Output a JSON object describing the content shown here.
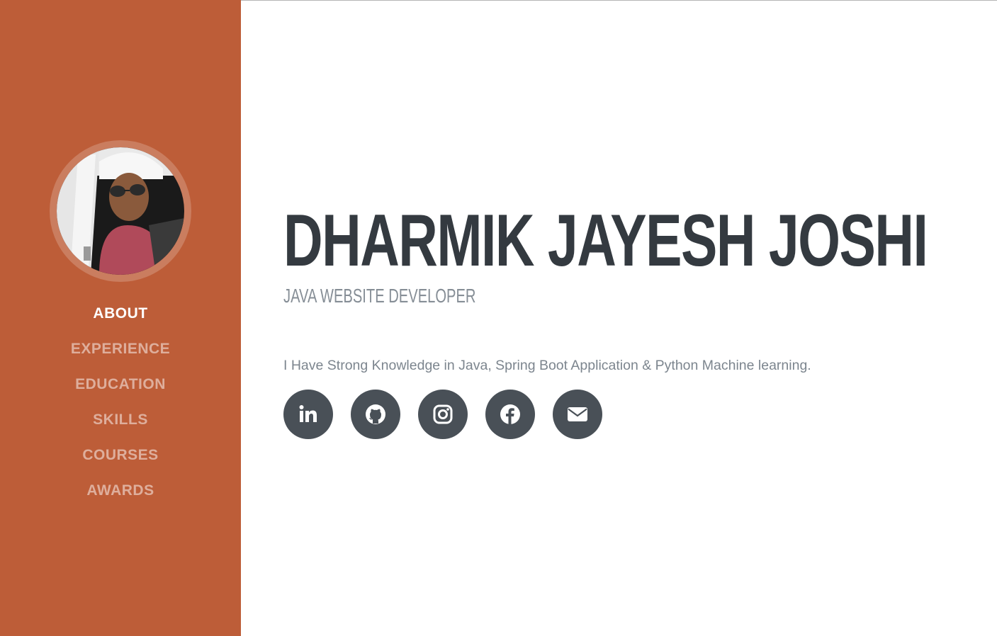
{
  "nav": {
    "items": [
      {
        "label": "ABOUT",
        "active": true
      },
      {
        "label": "EXPERIENCE",
        "active": false
      },
      {
        "label": "EDUCATION",
        "active": false
      },
      {
        "label": "SKILLS",
        "active": false
      },
      {
        "label": "COURSES",
        "active": false
      },
      {
        "label": "AWARDS",
        "active": false
      }
    ]
  },
  "profile": {
    "name": "DHARMIK JAYESH JOSHI",
    "subheading": "JAVA WEBSITE DEVELOPER",
    "lead": "I Have Strong Knowledge in Java, Spring Boot Application & Python Machine learning."
  },
  "social": [
    {
      "icon": "linkedin-icon"
    },
    {
      "icon": "github-icon"
    },
    {
      "icon": "instagram-icon"
    },
    {
      "icon": "facebook-icon"
    },
    {
      "icon": "envelope-icon"
    }
  ],
  "colors": {
    "sidebar": "#bd5d38",
    "heading": "#343a40",
    "subheading": "#868e96",
    "social_bg": "#495057"
  }
}
